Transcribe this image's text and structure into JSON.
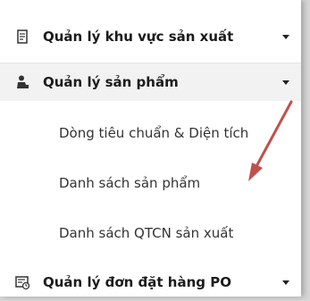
{
  "menu": {
    "items": [
      {
        "label": "Quản lý khu vực sản xuất",
        "icon": "document-icon"
      },
      {
        "label": "Quản lý sản phẩm",
        "icon": "worker-icon",
        "expanded": true
      },
      {
        "label": "Quản lý đơn đặt hàng PO",
        "icon": "order-icon"
      }
    ],
    "submenu": [
      {
        "label": "Dòng tiêu chuẩn & Diện tích"
      },
      {
        "label": "Danh sách sản phẩm"
      },
      {
        "label": "Danh sách QTCN sản xuất"
      }
    ]
  },
  "colors": {
    "arrow": "#c0504d",
    "active_background": "#f2f2f2",
    "text": "#1c1c1c"
  }
}
